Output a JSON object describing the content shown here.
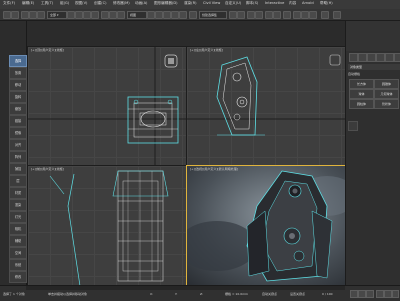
{
  "menubar": {
    "items": [
      "文件(F)",
      "编辑(E)",
      "工具(T)",
      "组(G)",
      "视图(V)",
      "创建(C)",
      "修改器(M)",
      "动画(A)",
      "图形编辑器(D)",
      "渲染(R)",
      "Civil View",
      "自定义(U)",
      "脚本(S)",
      "Interactive",
      "内容",
      "Arnold",
      "帮助(H)"
    ]
  },
  "mainbar": {
    "view_dropdown": "视图",
    "selection_set": "创建选择集"
  },
  "leftpanel": {
    "buttons": [
      "选择",
      "放置",
      "移动",
      "旋转",
      "缩放",
      "链接",
      "镜像",
      "对齐",
      "阵列",
      "捕捉",
      "层",
      "材质",
      "渲染",
      "灯光",
      "相机",
      "辅助",
      "空间",
      "系统",
      "修改",
      "层次"
    ]
  },
  "viewports": {
    "top_left": {
      "label": "[+][顶][用户定义][线框]"
    },
    "top_right": {
      "label": "[+][左][用户定义][线框]"
    },
    "bottom_left": {
      "label": "[+][前][用户定义][线框]"
    },
    "bottom_right": {
      "label": "[+][透视][用户定义][默认明暗处理]"
    }
  },
  "cmdpanel": {
    "title": "对象类型",
    "field": "自动栅格",
    "buttons": [
      "长方体",
      "圆锥体",
      "球体",
      "几何球体",
      "圆柱体",
      "管状体"
    ]
  },
  "statusbar": {
    "selection": "选择了 1 个对象",
    "hint": "单击并拖动以选择并移动对象",
    "x_label": "X:",
    "y_label": "Y:",
    "z_label": "Z:",
    "grid": "栅格 = 10.0mm",
    "frame": "0 / 100",
    "auto_key": "自动关键点",
    "set_key": "设置关键点"
  },
  "colors": {
    "accent": "#e0b43c",
    "wire_cyan": "#5ee0e6",
    "wire_white": "#e8e8e8"
  }
}
